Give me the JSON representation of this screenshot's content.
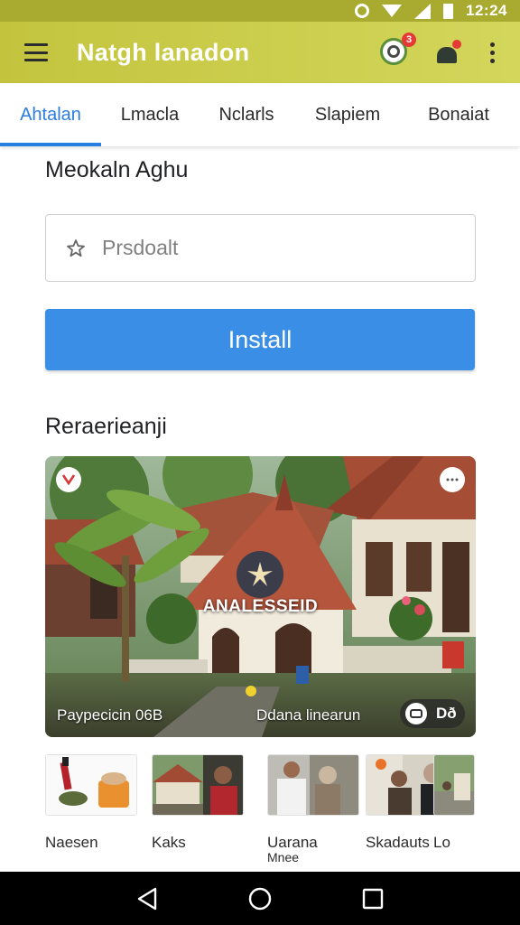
{
  "status_bar": {
    "time": "12:24"
  },
  "app_bar": {
    "title": "Natgh lanadon",
    "notification_count": "3"
  },
  "tabs": [
    {
      "label": "Ahtalan",
      "active": true
    },
    {
      "label": "Lmacla",
      "active": false
    },
    {
      "label": "Nclarls",
      "active": false
    },
    {
      "label": "Slapiem",
      "active": false
    },
    {
      "label": "Bonaiat",
      "active": false
    }
  ],
  "section1": {
    "title": "Meokaln Aghu"
  },
  "search": {
    "placeholder": "Prsdoalt"
  },
  "install_button": {
    "label": "Install"
  },
  "section2": {
    "title": "Reraerieanji"
  },
  "feature_card": {
    "overlay_title": "ANALESSEID",
    "caption_left": "Paypecicin 06B",
    "caption_mid": "Ddana linearun",
    "video_label": "Dð"
  },
  "thumbnails": [
    {
      "label": "Naesen",
      "sub": ""
    },
    {
      "label": "Kaks",
      "sub": ""
    },
    {
      "label": "Uarana",
      "sub": "Mnee"
    },
    {
      "label": "Skadauts",
      "sub": ""
    },
    {
      "label": "Lo",
      "sub": ""
    }
  ],
  "colors": {
    "accent": "#2a7de1",
    "app_bar": "#c3c43e",
    "install": "#3a8ee6"
  },
  "icons": {
    "menu": "menu-icon",
    "notification": "bell-icon",
    "hat": "hat-icon",
    "more": "more-vert-icon",
    "search": "star-outline-icon",
    "back": "back-icon",
    "home": "home-icon",
    "recents": "recents-icon"
  }
}
